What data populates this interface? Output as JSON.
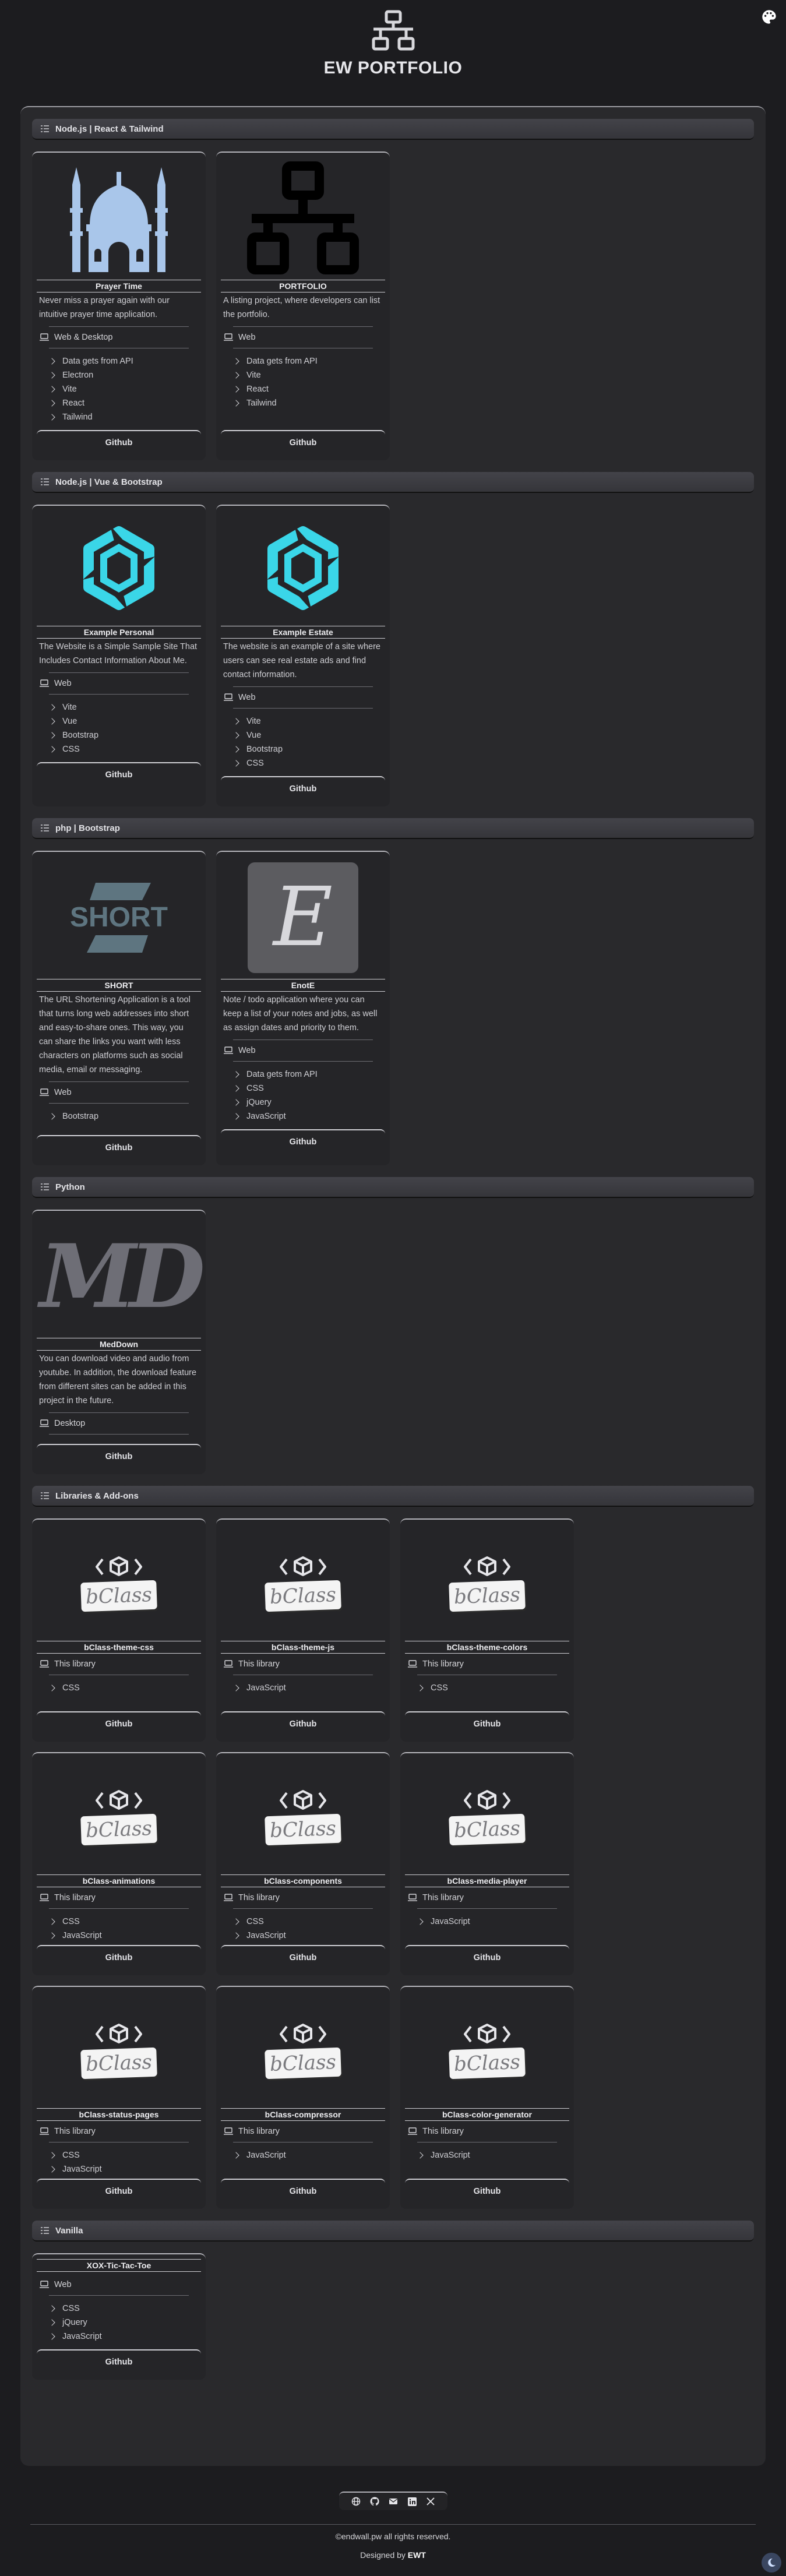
{
  "header": {
    "title": "EW PORTFOLIO"
  },
  "sections": [
    {
      "title": "Node.js | React & Tailwind"
    },
    {
      "title": "Node.js | Vue & Bootstrap"
    },
    {
      "title": "php | Bootstrap"
    },
    {
      "title": "Python"
    },
    {
      "title": "Libraries & Add-ons"
    },
    {
      "title": "Vanilla"
    }
  ],
  "projects": {
    "prayer": {
      "title": "Prayer Time",
      "desc": "Never miss a prayer again with our intuitive prayer time application.",
      "platform": "Web & Desktop",
      "techs": [
        "Data gets from API",
        "Electron",
        "Vite",
        "React",
        "Tailwind"
      ],
      "link": "Github"
    },
    "portfolio": {
      "title": "PORTFOLIO",
      "desc": "A listing project, where developers can list the portfolio.",
      "platform": "Web",
      "techs": [
        "Data gets from API",
        "Vite",
        "React",
        "Tailwind"
      ],
      "link": "Github"
    },
    "personal": {
      "title": "Example Personal",
      "desc": "The Website is a Simple Sample Site That Includes Contact Information About Me.",
      "platform": "Web",
      "techs": [
        "Vite",
        "Vue",
        "Bootstrap",
        "CSS"
      ],
      "link": "Github"
    },
    "estate": {
      "title": "Example Estate",
      "desc": "The website is an example of a site where users can see real estate ads and find contact information.",
      "platform": "Web",
      "techs": [
        "Vite",
        "Vue",
        "Bootstrap",
        "CSS"
      ],
      "link": "Github"
    },
    "short": {
      "title": "SHORT",
      "logo_text": "SHORT",
      "desc": "The URL Shortening Application is a tool that turns long web addresses into short and easy-to-share ones. This way, you can share the links you want with less characters on platforms such as social media, email or messaging.",
      "platform": "Web",
      "techs": [
        "Bootstrap"
      ],
      "link": "Github"
    },
    "enote": {
      "title": "EnotE",
      "logo_text": "E",
      "desc": "Note / todo application where you can keep a list of your notes and jobs, as well as assign dates and priority to them.",
      "platform": "Web",
      "techs": [
        "Data gets from API",
        "CSS",
        "jQuery",
        "JavaScript"
      ],
      "link": "Github"
    },
    "meddown": {
      "title": "MedDown",
      "logo_text": "MD",
      "desc": "You can download video and audio from youtube. In addition, the download feature from different sites can be added in this project in the future.",
      "platform": "Desktop",
      "link": "Github"
    },
    "xox": {
      "title": "XOX-Tic-Tac-Toe",
      "platform": "Web",
      "techs": [
        "CSS",
        "jQuery",
        "JavaScript"
      ],
      "link": "Github"
    }
  },
  "libraries": {
    "badge_text": "bClass",
    "items": [
      {
        "title": "bClass-theme-css",
        "platform": "This library",
        "techs": [
          "CSS"
        ],
        "link": "Github"
      },
      {
        "title": "bClass-theme-js",
        "platform": "This library",
        "techs": [
          "JavaScript"
        ],
        "link": "Github"
      },
      {
        "title": "bClass-theme-colors",
        "platform": "This library",
        "techs": [
          "CSS"
        ],
        "link": "Github"
      },
      {
        "title": "bClass-animations",
        "platform": "This library",
        "techs": [
          "CSS",
          "JavaScript"
        ],
        "link": "Github"
      },
      {
        "title": "bClass-components",
        "platform": "This library",
        "techs": [
          "CSS",
          "JavaScript"
        ],
        "link": "Github"
      },
      {
        "title": "bClass-media-player",
        "platform": "This library",
        "techs": [
          "JavaScript"
        ],
        "link": "Github"
      },
      {
        "title": "bClass-status-pages",
        "platform": "This library",
        "techs": [
          "CSS",
          "JavaScript"
        ],
        "link": "Github"
      },
      {
        "title": "bClass-compressor",
        "platform": "This library",
        "techs": [
          "JavaScript"
        ],
        "link": "Github"
      },
      {
        "title": "bClass-color-generator",
        "platform": "This library",
        "techs": [
          "JavaScript"
        ],
        "link": "Github"
      }
    ]
  },
  "footer": {
    "social_icons": [
      "globe-icon",
      "github-icon",
      "mail-icon",
      "linkedin-icon",
      "x-icon"
    ],
    "copyright": "©endwall.pw all rights reserved.",
    "designed_prefix": "Designed by",
    "designed_by": "EWT"
  },
  "colors": {
    "background": "#1c1c1f",
    "panel": "#29292c",
    "card": "#252528",
    "accent_cyan": "#3ad6e8",
    "prayer_blue": "#a9c6ea"
  }
}
